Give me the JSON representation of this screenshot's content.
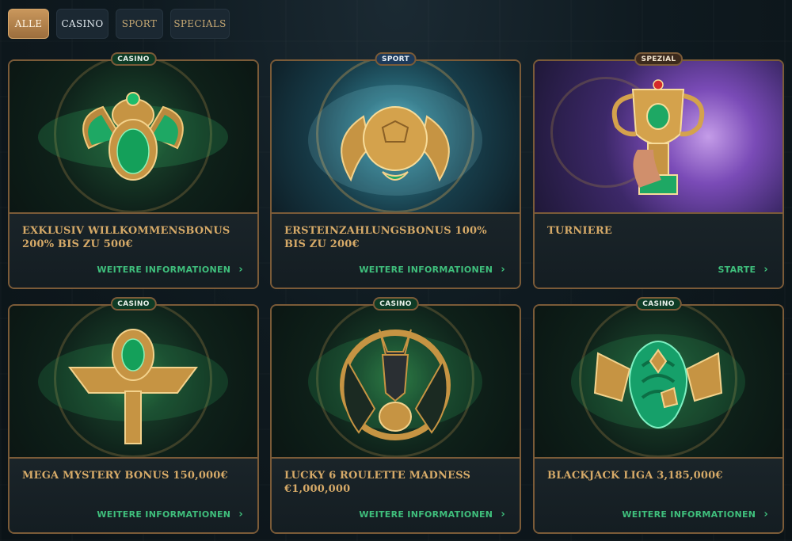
{
  "filters": [
    {
      "label": "ALLE",
      "active": true
    },
    {
      "label": "CASINO",
      "active": false
    },
    {
      "label": "SPORT",
      "active": false
    },
    {
      "label": "SPECIALS",
      "active": false
    }
  ],
  "cards": [
    {
      "badge": "CASINO",
      "title": "EXKLUSIV WILLKOMMENSBONUS 200% BIS ZU 500€",
      "link": "WEITERE INFORMATIONEN",
      "icon": "scarab-icon",
      "theme": "green"
    },
    {
      "badge": "SPORT",
      "title": "ERSTEINZAHLUNGSBONUS 100% BIS ZU 200€",
      "link": "WEITERE INFORMATIONEN",
      "icon": "winged-ball-icon",
      "theme": "blue"
    },
    {
      "badge": "SPEZIAL",
      "title": "TURNIERE",
      "link": "STARTE",
      "icon": "trophy-icon",
      "theme": "purple"
    },
    {
      "badge": "CASINO",
      "title": "MEGA MYSTERY BONUS 150,000€",
      "link": "WEITERE INFORMATIONEN",
      "icon": "ankh-icon",
      "theme": "green"
    },
    {
      "badge": "CASINO",
      "title": "LUCKY 6 ROULETTE MADNESS €1,000,000",
      "link": "WEITERE INFORMATIONEN",
      "icon": "anubis-icon",
      "theme": "green"
    },
    {
      "badge": "CASINO",
      "title": "BLACKJACK LIGA 3,185,000€",
      "link": "WEITERE INFORMATIONEN",
      "icon": "serpent-icon",
      "theme": "green"
    }
  ],
  "colors": {
    "gold": "#d6aa68",
    "link_green": "#3fbf7c",
    "card_border": "#7b5b38"
  }
}
